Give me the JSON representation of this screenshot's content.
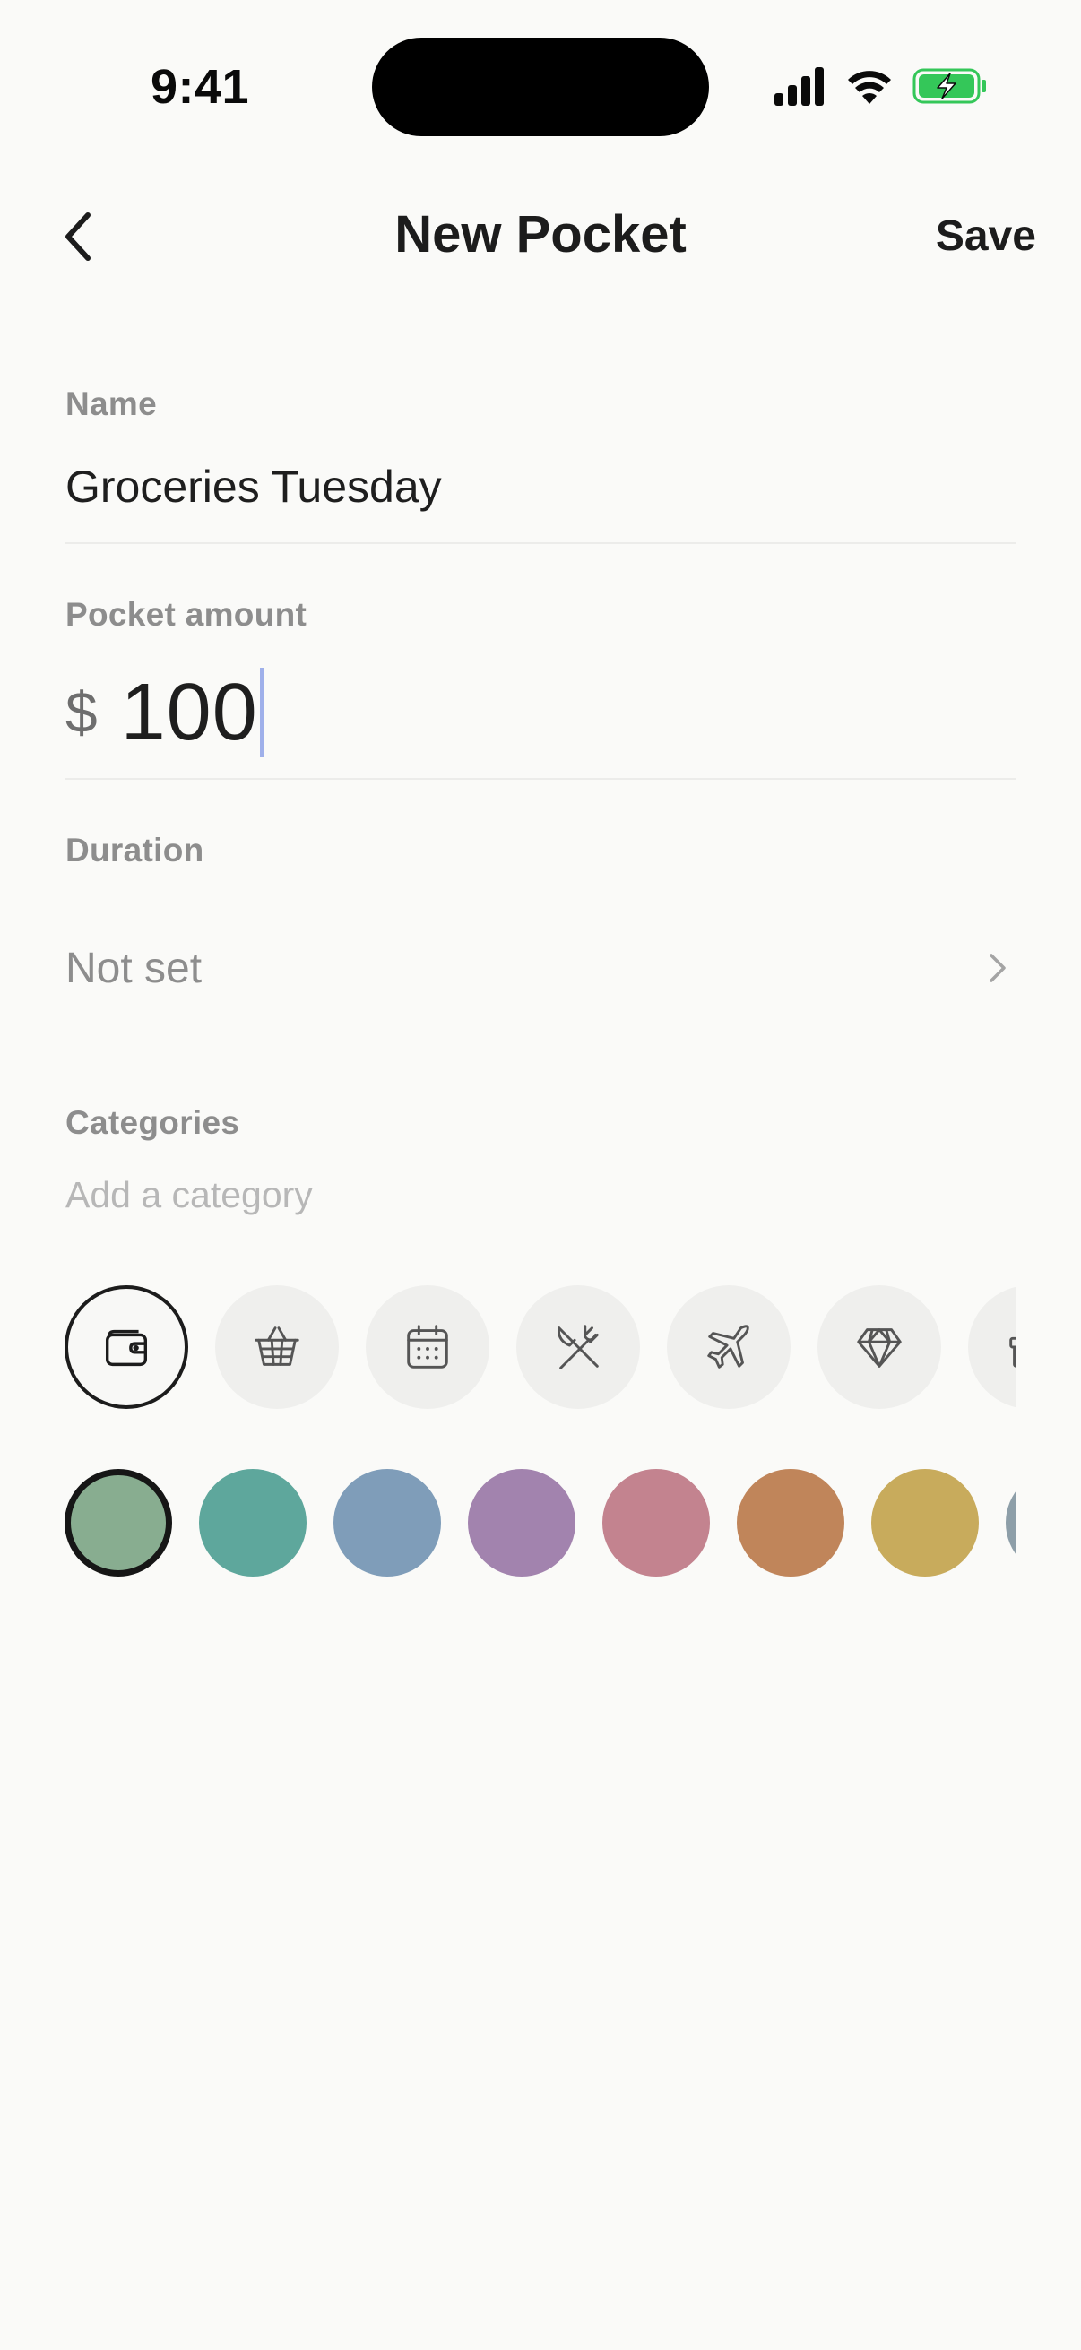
{
  "status_bar": {
    "time": "9:41",
    "icons": [
      "cellular-signal-icon",
      "wifi-icon",
      "battery-charging-icon"
    ],
    "battery_color": "#34c759"
  },
  "nav": {
    "back_icon": "chevron-left-icon",
    "title": "New Pocket",
    "save_label": "Save"
  },
  "form": {
    "name": {
      "label": "Name",
      "value": "Groceries Tuesday"
    },
    "amount": {
      "label": "Pocket amount",
      "currency": "$",
      "value": "100"
    },
    "duration": {
      "label": "Duration",
      "value": "Not set",
      "chevron_icon": "chevron-right-icon"
    },
    "categories": {
      "label": "Categories",
      "placeholder": "Add a category"
    }
  },
  "icon_options": [
    {
      "name": "wallet-icon",
      "selected": true
    },
    {
      "name": "basket-icon",
      "selected": false
    },
    {
      "name": "calendar-icon",
      "selected": false
    },
    {
      "name": "utensils-icon",
      "selected": false
    },
    {
      "name": "airplane-icon",
      "selected": false
    },
    {
      "name": "diamond-icon",
      "selected": false
    },
    {
      "name": "gift-icon",
      "selected": false
    }
  ],
  "color_options": [
    {
      "hex": "#88ad90",
      "selected": true
    },
    {
      "hex": "#5ea79c",
      "selected": false
    },
    {
      "hex": "#7f9db9",
      "selected": false
    },
    {
      "hex": "#a283ae",
      "selected": false
    },
    {
      "hex": "#c3838f",
      "selected": false
    },
    {
      "hex": "#c0855a",
      "selected": false
    },
    {
      "hex": "#c8ab5c",
      "selected": false
    },
    {
      "hex": "#8d9ea8",
      "selected": false
    }
  ],
  "colors": {
    "background": "#fafaf8",
    "text_primary": "#1c1c1c",
    "text_secondary": "#8d8d8d",
    "caret": "#9fb0ea"
  }
}
